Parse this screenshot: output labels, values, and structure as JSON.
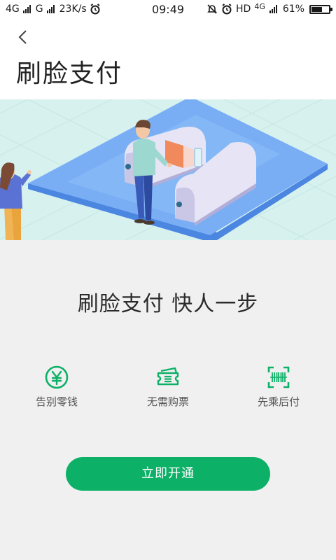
{
  "status_bar": {
    "network1": "4G",
    "network2": "G",
    "speed": "23K/s",
    "time": "09:49",
    "hd": "HD",
    "network3": "4G",
    "battery_text": "61%",
    "battery_level": 0.61,
    "icons": [
      "alarm-icon",
      "mute-icon",
      "alarm-icon"
    ]
  },
  "header": {
    "title": "刷脸支付",
    "back_icon": "chevron-left-icon"
  },
  "hero": {
    "image": "face-pay-turnstile-illustration",
    "background_color": "#d7f1ef",
    "platform_color": "#78aef5"
  },
  "main": {
    "headline": "刷脸支付 快人一步",
    "features": [
      {
        "icon": "yuan-coin-icon",
        "label": "告别零钱"
      },
      {
        "icon": "ticket-icon",
        "label": "无需购票"
      },
      {
        "icon": "scan-barcode-icon",
        "label": "先乘后付"
      }
    ],
    "cta_label": "立即开通",
    "accent_color": "#0db067"
  }
}
